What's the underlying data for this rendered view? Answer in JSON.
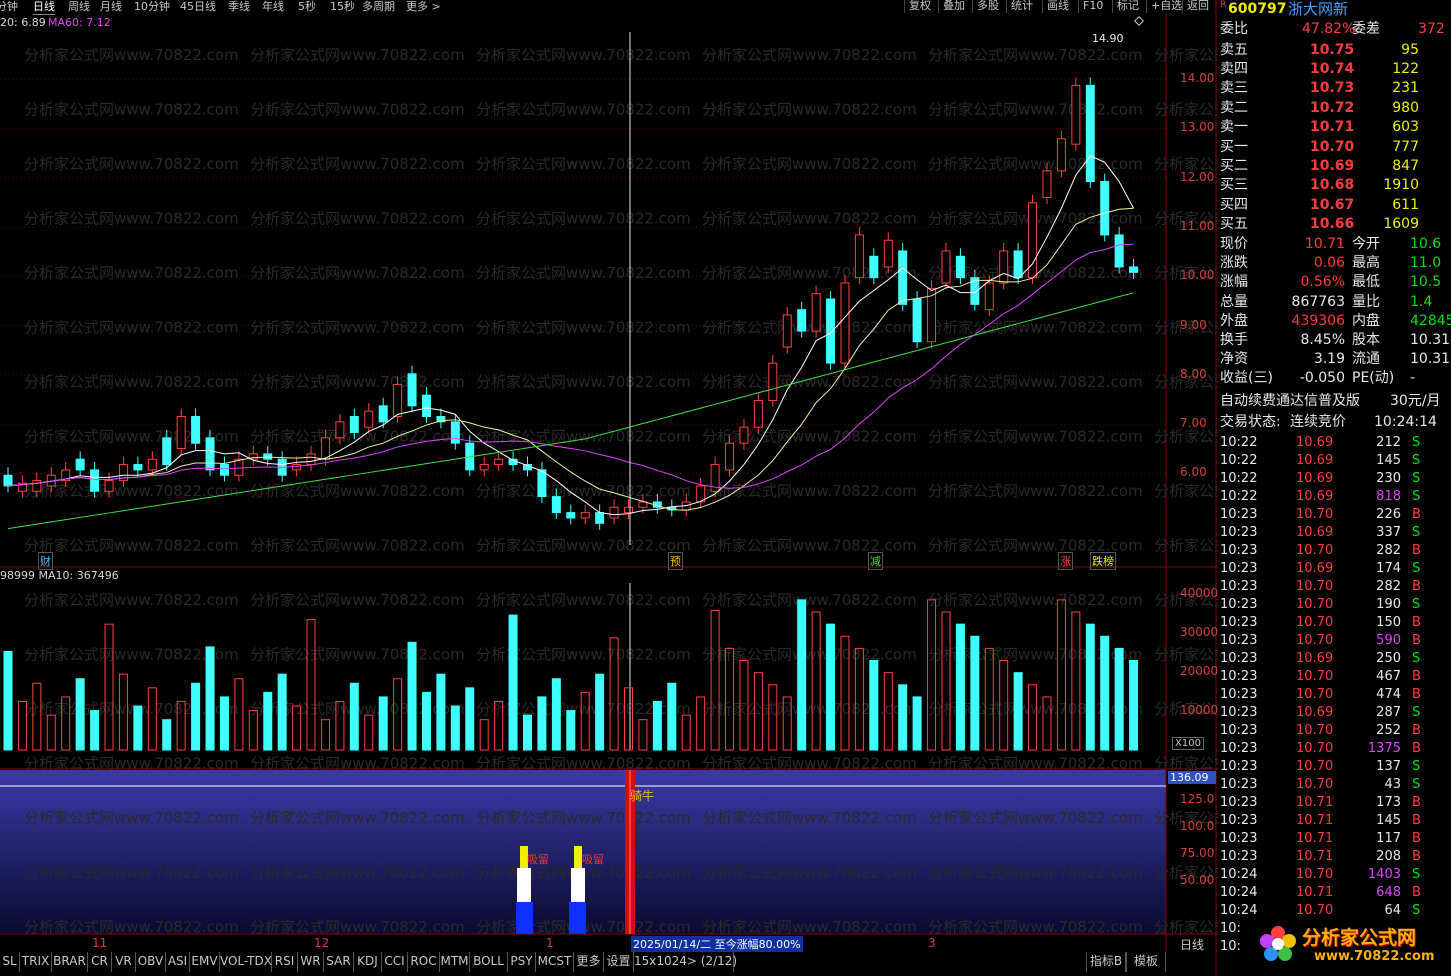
{
  "toolbar": {
    "items": [
      "分钟",
      "日线",
      "周线",
      "月线",
      "10分钟",
      "45日线",
      "季线",
      "年线",
      "5秒",
      "15秒",
      "多周期",
      "更多 >"
    ],
    "right": [
      "复权",
      "叠加",
      "多股",
      "统计",
      "画线",
      "F10",
      "标记",
      "+自选",
      "返回"
    ]
  },
  "main": {
    "ma_label_a": "20: 6.89",
    "ma_label_b": "MA60: 7.12",
    "high_label": "14.90",
    "price_ticks": [
      "14.00",
      "13.00",
      "12.00",
      "11.00",
      "10.00",
      "9.00",
      "8.00",
      "7.00",
      "6.00"
    ],
    "event_tags": [
      "财",
      "预",
      "减",
      "涨",
      "跌榜"
    ]
  },
  "volume": {
    "label": "98999  MA10: 367496",
    "ticks": [
      "40000",
      "30000",
      "20000",
      "10000"
    ],
    "unit": "X100"
  },
  "indicator": {
    "top_value": "136.09",
    "ticks": [
      "125.0",
      "100.0",
      "75.00",
      "50.00"
    ],
    "tag_a": "吸留",
    "tag_b": "吸留",
    "tag_c": "骑牛"
  },
  "date_axis": {
    "labels": [
      "11",
      "12",
      "1",
      "3"
    ],
    "cursor_info": "2025/01/14/二  至今涨幅80.00%",
    "period": "日线"
  },
  "bottom_tabs": [
    "SL",
    "TRIX",
    "BRAR",
    "CR",
    "VR",
    "OBV",
    "ASI",
    "EMV",
    "VOL-TDX",
    "RSI",
    "WR",
    "SAR",
    "KDJ",
    "CCI",
    "ROC",
    "MTM",
    "BOLL",
    "PSY",
    "MCST",
    "更多",
    "设置",
    "15x1024> (2/12)"
  ],
  "bottom_right": [
    "指标B",
    "模板"
  ],
  "watermark": "分析家公式网www.70822.com",
  "quote": {
    "code": "600797",
    "name": "浙大网新",
    "wb_label": "委比",
    "wb_value": "47.82%",
    "wc_label": "委差",
    "wc_value": "372",
    "asks": [
      {
        "label": "卖五",
        "price": "10.75",
        "vol": "95"
      },
      {
        "label": "卖四",
        "price": "10.74",
        "vol": "122"
      },
      {
        "label": "卖三",
        "price": "10.73",
        "vol": "231"
      },
      {
        "label": "卖二",
        "price": "10.72",
        "vol": "980"
      },
      {
        "label": "卖一",
        "price": "10.71",
        "vol": "603"
      }
    ],
    "bids": [
      {
        "label": "买一",
        "price": "10.70",
        "vol": "777"
      },
      {
        "label": "买二",
        "price": "10.69",
        "vol": "847"
      },
      {
        "label": "买三",
        "price": "10.68",
        "vol": "1910"
      },
      {
        "label": "买四",
        "price": "10.67",
        "vol": "611"
      },
      {
        "label": "买五",
        "price": "10.66",
        "vol": "1609"
      }
    ],
    "stats": [
      {
        "l1": "现价",
        "v1": "10.71",
        "l2": "今开",
        "v2": "10.6"
      },
      {
        "l1": "涨跌",
        "v1": "0.06",
        "l2": "最高",
        "v2": "11.0"
      },
      {
        "l1": "涨幅",
        "v1": "0.56%",
        "l2": "最低",
        "v2": "10.5"
      },
      {
        "l1": "总量",
        "v1": "867763",
        "l2": "量比",
        "v2": "1.4"
      },
      {
        "l1": "外盘",
        "v1": "439306",
        "l2": "内盘",
        "v2": "42845"
      },
      {
        "l1": "换手",
        "v1": "8.45%",
        "l2": "股本",
        "v2": "10.31"
      },
      {
        "l1": "净资",
        "v1": "3.19",
        "l2": "流通",
        "v2": "10.31"
      },
      {
        "l1": "收益(三)",
        "v1": "-0.050",
        "l2": "PE(动)",
        "v2": "-"
      }
    ],
    "ad_text": "自动续费通达信普及版",
    "ad_price": "30元/月",
    "status_label": "交易状态:",
    "status_value": "连续竞价",
    "status_time": "10:24:14"
  },
  "ticks": [
    [
      "10:22",
      "10.69",
      "212",
      "S"
    ],
    [
      "10:22",
      "10.69",
      "145",
      "S"
    ],
    [
      "10:22",
      "10.69",
      "230",
      "S"
    ],
    [
      "10:22",
      "10.69",
      "818",
      "S"
    ],
    [
      "10:23",
      "10.70",
      "226",
      "B"
    ],
    [
      "10:23",
      "10.69",
      "337",
      "S"
    ],
    [
      "10:23",
      "10.70",
      "282",
      "B"
    ],
    [
      "10:23",
      "10.69",
      "174",
      "S"
    ],
    [
      "10:23",
      "10.70",
      "282",
      "B"
    ],
    [
      "10:23",
      "10.70",
      "190",
      "S"
    ],
    [
      "10:23",
      "10.70",
      "150",
      "B"
    ],
    [
      "10:23",
      "10.70",
      "590",
      "B"
    ],
    [
      "10:23",
      "10.69",
      "250",
      "S"
    ],
    [
      "10:23",
      "10.70",
      "467",
      "B"
    ],
    [
      "10:23",
      "10.70",
      "474",
      "B"
    ],
    [
      "10:23",
      "10.69",
      "287",
      "S"
    ],
    [
      "10:23",
      "10.70",
      "252",
      "B"
    ],
    [
      "10:23",
      "10.70",
      "1375",
      "B"
    ],
    [
      "10:23",
      "10.70",
      "137",
      "S"
    ],
    [
      "10:23",
      "10.70",
      "43",
      "S"
    ],
    [
      "10:23",
      "10.71",
      "173",
      "B"
    ],
    [
      "10:23",
      "10.71",
      "145",
      "B"
    ],
    [
      "10:23",
      "10.71",
      "117",
      "B"
    ],
    [
      "10:23",
      "10.71",
      "208",
      "B"
    ],
    [
      "10:24",
      "10.70",
      "1403",
      "S"
    ],
    [
      "10:24",
      "10.71",
      "648",
      "B"
    ],
    [
      "10:24",
      "10.70",
      "64",
      "S"
    ],
    [
      "10:",
      "",
      "",
      " "
    ],
    [
      "10:",
      "",
      "",
      " "
    ]
  ],
  "logo": {
    "text": "分析家公式网",
    "url": "www.70822.com"
  }
}
